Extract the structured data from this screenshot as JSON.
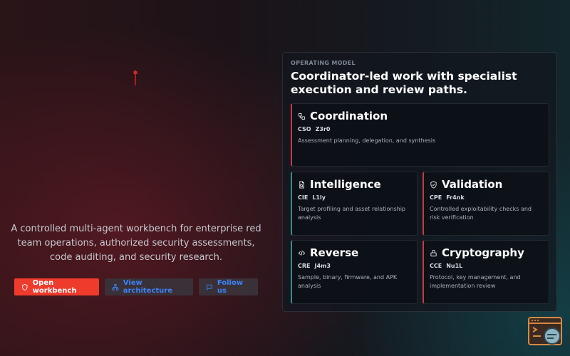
{
  "hero": {
    "tagline": "A controlled multi-agent workbench for enterprise red team operations, authorized security assessments, code auditing, and security research.",
    "buttons": {
      "open_label": "Open workbench",
      "architecture_label": "View architecture",
      "follow_label": "Follow us"
    }
  },
  "operating_model": {
    "eyebrow": "OPERATING MODEL",
    "title": "Coordinator-led work with specialist execution and review paths.",
    "cards": [
      {
        "title": "Coordination",
        "role": "CSO",
        "handle": "Z3r0",
        "description": "Assessment planning, delegation, and synthesis",
        "icon": "workflow-icon"
      },
      {
        "title": "Intelligence",
        "role": "CIE",
        "handle": "L1ly",
        "description": "Target profiling and asset relationship analysis",
        "icon": "file-search-icon"
      },
      {
        "title": "Validation",
        "role": "CPE",
        "handle": "Fr4nk",
        "description": "Controlled exploitability checks and risk verification",
        "icon": "shield-check-icon"
      },
      {
        "title": "Reverse",
        "role": "CRE",
        "handle": "J4m3",
        "description": "Sample, binary, firmware, and APK analysis",
        "icon": "code-icon"
      },
      {
        "title": "Cryptography",
        "role": "CCE",
        "handle": "Nu1L",
        "description": "Protocol, key management, and implementation review",
        "icon": "lock-icon"
      }
    ]
  },
  "colors": {
    "accent_red": "#ef3b2c",
    "link_blue": "#3b82f6",
    "card_red_border": "#c43a4a",
    "card_teal_border": "#2e8f8c"
  }
}
